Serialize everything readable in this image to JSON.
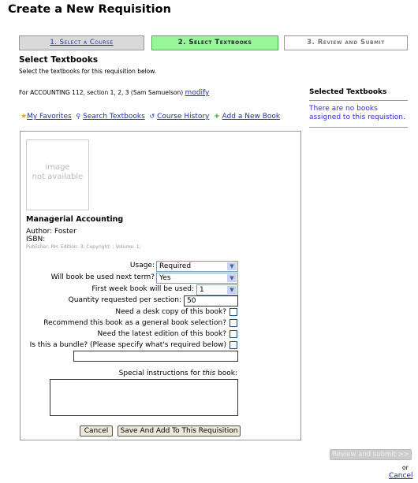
{
  "page_title": "Create a New Requisition",
  "steps": [
    {
      "label": "1. Select a Course"
    },
    {
      "label": "2. Select Textbooks"
    },
    {
      "label": "3. Review and Submit"
    }
  ],
  "section": {
    "title": "Select Textbooks",
    "subtitle": "Select the textbooks for this requisition below.",
    "course_info": "For ACCOUNTING 112, section 1, 2, 3 (Sam Samuelson)",
    "modify": "modify"
  },
  "links": [
    {
      "label": "My Favorites",
      "icon": "star-icon"
    },
    {
      "label": "Search Textbooks",
      "icon": "search-icon"
    },
    {
      "label": "Course History",
      "icon": "history-icon"
    },
    {
      "label": "Add a New Book",
      "icon": "plus-icon"
    }
  ],
  "book": {
    "image_text_1": "image",
    "image_text_2": "not available",
    "title": "Managerial Accounting",
    "author": "Author: Foster",
    "isbn": "ISBN:",
    "details": "Publisher: RH; Edition: 3; Copyright: ; Volume: 1;"
  },
  "form": {
    "usage_label": "Usage:",
    "usage_value": "Required",
    "next_term_label": "Will book be used next term?",
    "next_term_value": "Yes",
    "first_week_label": "First week book will be used:",
    "first_week_value": "1",
    "quantity_label": "Quantity requested per section:",
    "quantity_value": "50",
    "desk_copy_label": "Need a desk copy of this book?",
    "recommend_label": "Recommend this book as a general book selection?",
    "latest_label": "Need the latest edition of this book?",
    "bundle_label": "Is this a bundle? (Please specify what's required below)",
    "bundle_value": "",
    "special_pre": "Special instructions for ",
    "special_em": "this",
    "special_post": " book:",
    "special_value": "",
    "cancel": "Cancel",
    "save": "Save And Add To This Requisition"
  },
  "sidebar": {
    "title": "Selected Textbooks",
    "empty": "There are no books assigned to this requistion."
  },
  "footer": {
    "review": "Review and submit >>",
    "or": "or",
    "cancel": "Cancel"
  }
}
